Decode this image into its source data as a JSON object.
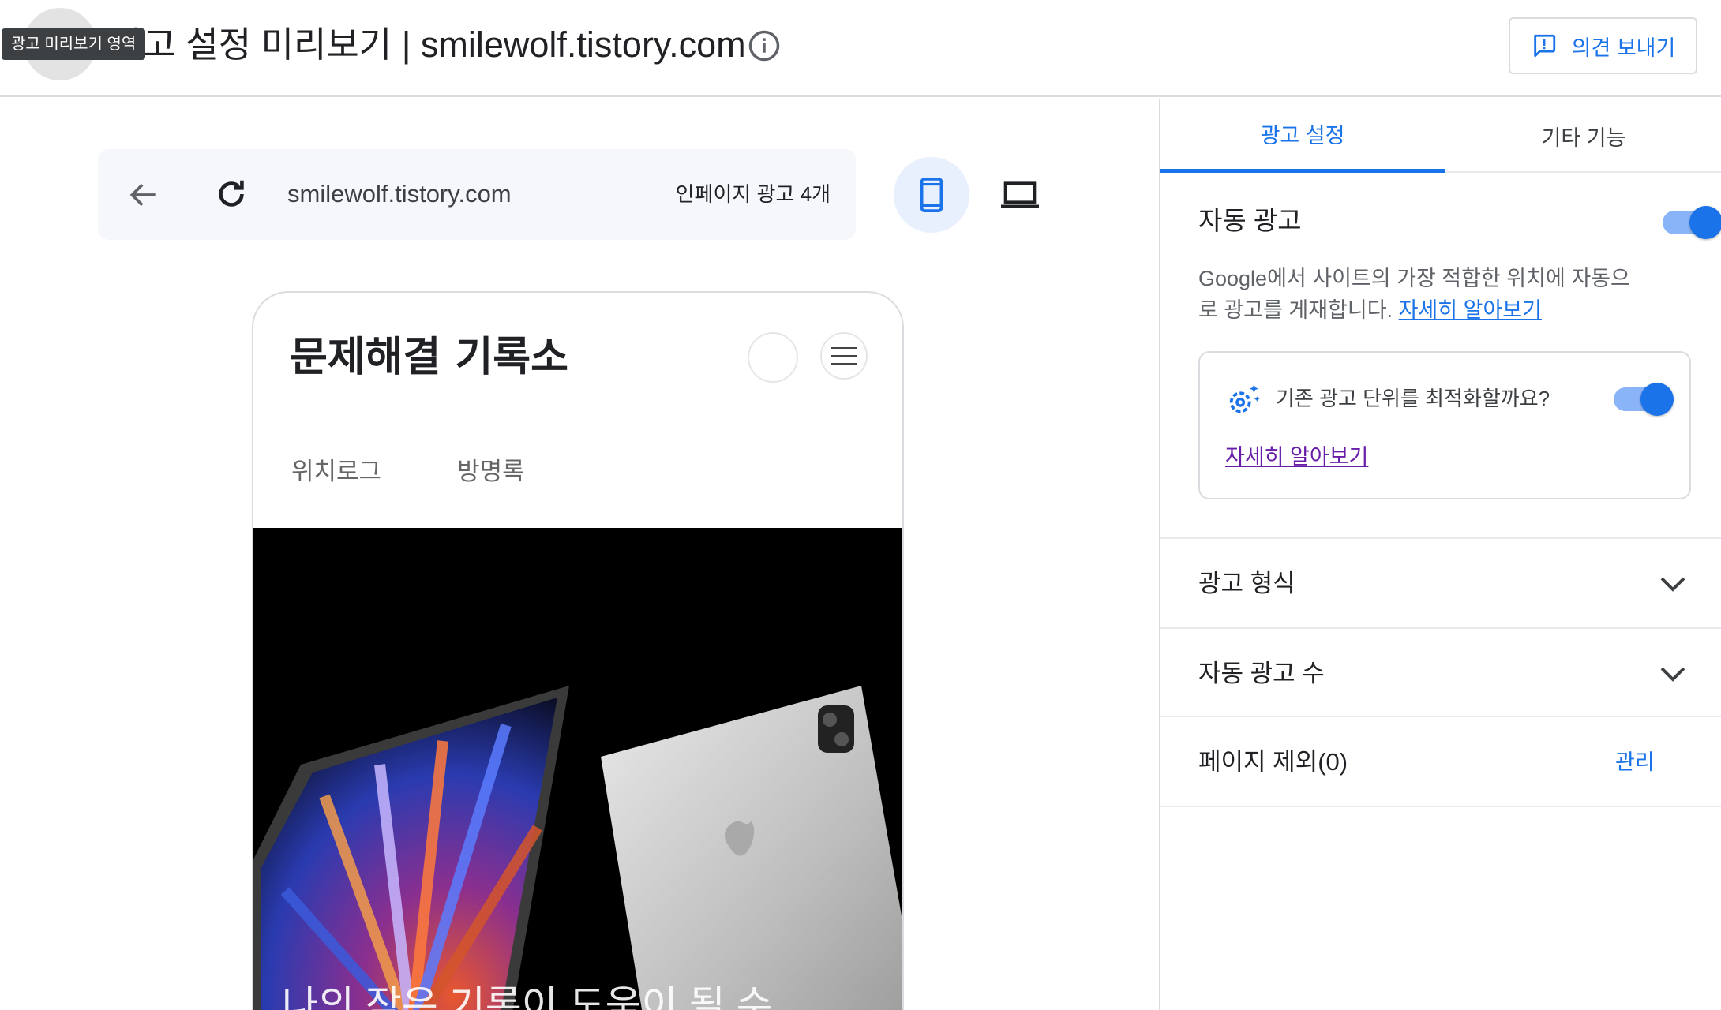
{
  "header": {
    "title": "광고 설정 미리보기 | smilewolf.tistory.com",
    "tooltip": "광고 미리보기 영역",
    "feedback_label": "의견 보내기"
  },
  "preview": {
    "url": "smilewolf.tistory.com",
    "inpage_ads": "인페이지 광고 4개",
    "blog": {
      "title": "문제해결 기록소",
      "nav": [
        "위치로그",
        "방명록"
      ],
      "hero_text": "나의 작은 기록이 도움이 될 수"
    }
  },
  "panel": {
    "tabs": [
      {
        "label": "광고 설정",
        "active": true
      },
      {
        "label": "기타 기능",
        "active": false
      }
    ],
    "auto_ads": {
      "title": "자동 광고",
      "enabled": true,
      "description": "Google에서 사이트의 가장 적합한 위치에 자동으로 광고를 게재합니다.",
      "learn_more": "자세히 알아보기"
    },
    "optimize": {
      "label": "기존 광고 단위를 최적화할까요?",
      "enabled": true,
      "learn_more": "자세히 알아보기"
    },
    "sections": {
      "ad_format": "광고 형식",
      "auto_ads_count": "자동 광고 수",
      "page_exclusion": "페이지 제외(0)",
      "manage": "관리"
    }
  },
  "colors": {
    "accent": "#1a73e8",
    "toggle_track": "#8ab4f8",
    "visited_link": "#681da8"
  }
}
